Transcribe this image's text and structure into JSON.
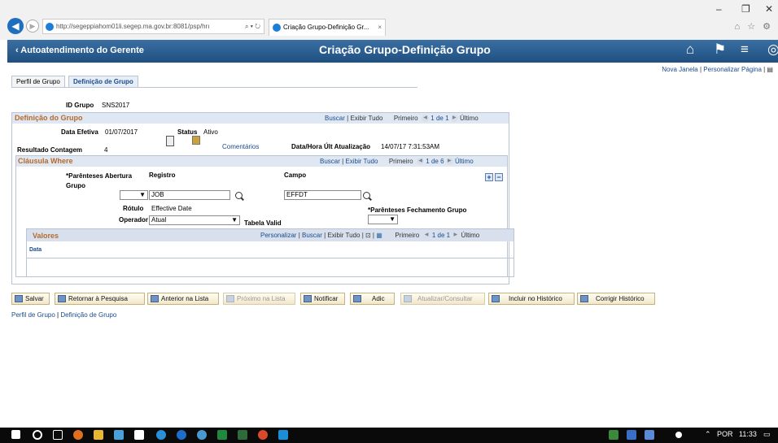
{
  "browser": {
    "window_controls": [
      "–",
      "❐",
      "✕"
    ],
    "address": "http://segeppiahom01li.segep.ma.gov.br:8081/psp/hrı",
    "address_controls": "⌕ ▾ ↻",
    "tab_title": "Criação Grupo-Definição Gr...",
    "tab_close": "×",
    "right_icons": "⌂ ☆ ⚙"
  },
  "header": {
    "back_label": "‹  Autoatendimento do Gerente",
    "title": "Criação Grupo-Definição Grupo",
    "icons": [
      "home-icon",
      "flag-icon",
      "menu-icon",
      "compass-icon"
    ]
  },
  "top_links": {
    "new_window": "Nova Janela",
    "sep": " | ",
    "personalize": "Personalizar Página",
    "tail": " | ▤"
  },
  "tabs": [
    {
      "label": "Perfil de Grupo",
      "active": false
    },
    {
      "label": "Definição de Grupo",
      "active": true
    }
  ],
  "form": {
    "id_label": "ID Grupo",
    "id_value": "SNS2017",
    "group": {
      "title": "Definição do Grupo",
      "find": "Buscar",
      "sep": " | ",
      "view_all": "Exibir Tudo",
      "first": "Primeiro",
      "count": "1 de 1",
      "last": "Último",
      "effdate_label": "Data Efetiva",
      "effdate_value": "01/07/2017",
      "status_label": "Status",
      "status_value": "Ativo",
      "result_label": "Resultado Contagem",
      "result_value": "4",
      "comments": "Comentários",
      "lastupdate_label": "Data/Hora Últ Atualização",
      "lastupdate_value": "14/07/17  7:31:53AM"
    },
    "where": {
      "title": "Cláusula Where",
      "find": "Buscar",
      "sep": " | ",
      "view_all": "Exibir Tudo",
      "first": "Primeiro",
      "count": "1 de 6",
      "last": "Último",
      "open_paren_label": "*Parênteses Abertura Grupo",
      "record_label": "Registro",
      "field_label": "Campo",
      "record_value": "JOB",
      "field_value": "EFFDT",
      "label_label": "Rótulo",
      "label_value": "Effective Date",
      "close_paren_label": "*Parênteses Fechamento Grupo",
      "operator_label": "Operador",
      "operator_value": "Atual",
      "table_valid": "Tabela Valid",
      "add_btn": "+",
      "remove_btn": "−"
    },
    "values": {
      "title": "Valores",
      "personalize": "Personalizar",
      "find": "Buscar",
      "view_all": "Exibir Tudo",
      "sep": " | ",
      "first": "Primeiro",
      "count": "1 de 1",
      "last": "Último",
      "col_date": "Data"
    }
  },
  "toolbar": [
    {
      "label": "Salvar",
      "disabled": false
    },
    {
      "label": "Retornar à Pesquisa",
      "disabled": false
    },
    {
      "label": "Anterior na Lista",
      "disabled": false
    },
    {
      "label": "Próximo na Lista",
      "disabled": true
    },
    {
      "label": "Notificar",
      "disabled": false
    },
    {
      "label": "Adic",
      "disabled": false
    },
    {
      "label": "Atualizar/Consultar",
      "disabled": true
    },
    {
      "label": "Incluir no Histórico",
      "disabled": false
    },
    {
      "label": "Corrigir Histórico",
      "disabled": false
    }
  ],
  "bottom_links": {
    "profile": "Perfil de Grupo",
    "sep": " | ",
    "definition": "Definição de Grupo"
  },
  "taskbar": {
    "language": "POR",
    "time": "11:33",
    "tray_caret": "⌃"
  }
}
